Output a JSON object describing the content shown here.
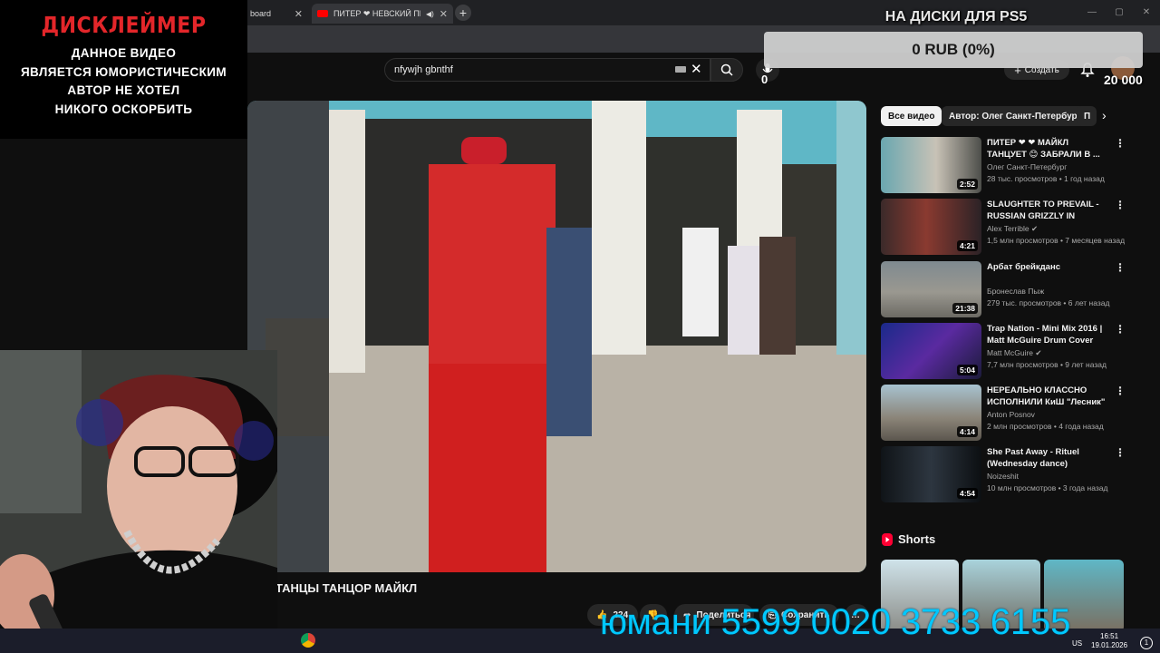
{
  "browser": {
    "tabs": [
      {
        "title": "board",
        "active": false
      },
      {
        "title": "ПИТЕР ❤ НЕВСКИЙ ПРОСПЕКТ",
        "active": true
      }
    ],
    "new_tab_symbol": "+",
    "close_symbol": "✕"
  },
  "youtube": {
    "search_value": "nfywjh gbnthf",
    "create_label": "Создать",
    "mic_counter": "0"
  },
  "overlay": {
    "disclaimer_title": "ДИСКЛЕЙМЕР",
    "disclaimer_lines": [
      "ДАННОЕ ВИДЕО",
      "ЯВЛЯЕТСЯ ЮМОРИСТИЧЕСКИМ",
      "АВТОР НЕ ХОТЕЛ",
      "НИКОГО ОСКОРБИТЬ"
    ],
    "donation_title": "НА ДИСКИ ДЛЯ PS5",
    "donation_progress": "0 RUB (0%)",
    "donation_count": "20 000",
    "promo_text": "юмани 5599 0020 3733 6155"
  },
  "video": {
    "title": "ТАНЦЫ ТАНЦОР МАЙКЛ",
    "likes": "224",
    "share_label": "Поделиться",
    "save_label": "Сохранить"
  },
  "sidebar": {
    "chips": [
      "Все видео",
      "Автор: Олег Санкт-Петербург",
      "П"
    ],
    "recommendations": [
      {
        "title": "ПИТЕР ❤ ❤ МАЙКЛ ТАНЦУЕТ 😊 ЗАБРАЛИ В ...",
        "channel": "Олег Санкт-Петербург",
        "meta": "28 тыс. просмотров • 1 год назад",
        "duration": "2:52",
        "verified": false
      },
      {
        "title": "SLAUGHTER TO PREVAIL - RUSSIAN GRIZZLY IN AMERIC...",
        "channel": "Alex Terrible",
        "meta": "1,5 млн просмотров • 7 месяцев назад",
        "duration": "4:21",
        "verified": true
      },
      {
        "title": "Арбат брейкданс",
        "channel": "Бронеслав Пыж",
        "meta": "279 тыс. просмотров • 6 лет назад",
        "duration": "21:38",
        "verified": false
      },
      {
        "title": "Trap Nation - Mini Mix 2016 | Matt McGuire Drum Cover",
        "channel": "Matt McGuire",
        "meta": "7,7 млн просмотров • 9 лет назад",
        "duration": "5:04",
        "verified": true
      },
      {
        "title": "НЕРЕАЛЬНО КЛАССНО ИСПОЛНИЛИ КиШ \"Лесник\" ...",
        "channel": "Anton Posnov",
        "meta": "2 млн просмотров • 4 года назад",
        "duration": "4:14",
        "verified": false
      },
      {
        "title": "She Past Away - Rituel (Wednesday dance)",
        "channel": "Noizeshit",
        "meta": "10 млн просмотров • 3 года назад",
        "duration": "4:54",
        "verified": false
      }
    ],
    "shorts_label": "Shorts"
  },
  "taskbar": {
    "lang": "US",
    "time": "16:51",
    "date": "19.01.2026",
    "notifications": "1"
  },
  "colors": {
    "background": "#0f0f0f",
    "disclaimer_red": "#e3262a",
    "promo_cyan": "#00c8ff",
    "youtube_red": "#ff0000"
  }
}
